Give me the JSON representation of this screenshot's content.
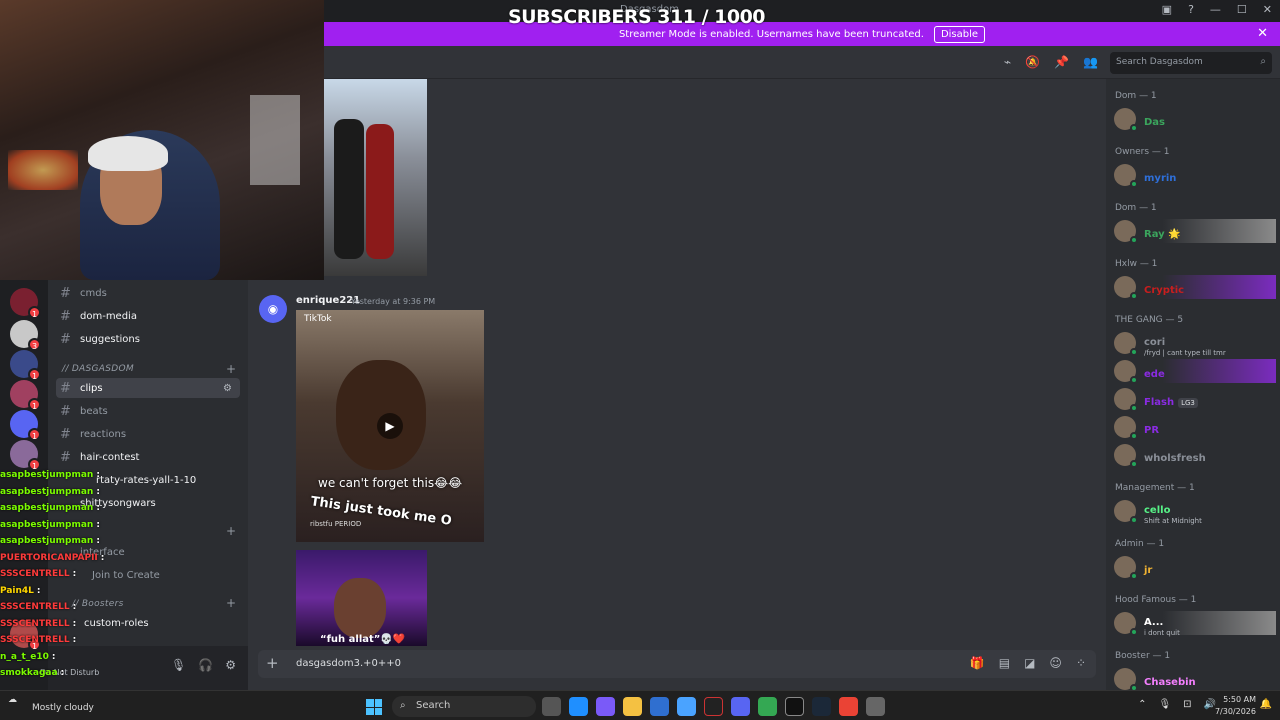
{
  "window": {
    "title": "Dasgasdom",
    "overlay": "SUBSCRIBERS 311 / 1000"
  },
  "banner": {
    "text": "Streamer Mode is enabled. Usernames have been truncated.",
    "button": "Disable"
  },
  "header": {
    "search_placeholder": "Search Dasgasdom"
  },
  "channels": {
    "top": [
      {
        "name": "cmds"
      },
      {
        "name": "dom-media"
      },
      {
        "name": "suggestions"
      }
    ],
    "category1": "// DASGASDOM",
    "list": [
      {
        "name": "clips"
      },
      {
        "name": "beats"
      },
      {
        "name": "reactions"
      },
      {
        "name": "hair-contest"
      },
      {
        "name": "rtaty-rates-yall-1-10"
      },
      {
        "name": "shittysongwars"
      }
    ],
    "voice1": "interface",
    "voice2": "Join to Create",
    "category2": "// Boosters",
    "boosters": [
      {
        "name": "custom-roles"
      }
    ]
  },
  "chat_overlay": [
    {
      "user": "asapbestjumpman",
      "msg": ":",
      "color": "#7CFC00"
    },
    {
      "user": "asapbestjumpman",
      "msg": ":",
      "color": "#7CFC00"
    },
    {
      "user": "asapbestjumpman",
      "msg": ":",
      "color": "#7CFC00"
    },
    {
      "user": "asapbestjumpman",
      "msg": ":",
      "color": "#7CFC00"
    },
    {
      "user": "asapbestjumpman",
      "msg": ":",
      "color": "#7CFC00"
    },
    {
      "user": "PUERTORICANPAPII",
      "msg": ":",
      "color": "#ff3b3b"
    },
    {
      "user": "SSSCENTRELL",
      "msg": ":",
      "color": "#ff3b3b"
    },
    {
      "user": "Pain4L",
      "msg": ":",
      "color": "#ffd700"
    },
    {
      "user": "SSSCENTRELL",
      "msg": ":",
      "color": "#ff3b3b"
    },
    {
      "user": "SSSCENTRELL",
      "msg": ":",
      "color": "#ff3b3b"
    },
    {
      "user": "SSSCENTRELL",
      "msg": ":",
      "color": "#ff3b3b"
    },
    {
      "user": "n_a_t_e10",
      "msg": ":",
      "color": "#7CFC00"
    },
    {
      "user": "smokkagaa",
      "msg": ":",
      "color": "#7CFC00"
    }
  ],
  "user_panel": {
    "status": "Do Not Disturb"
  },
  "message": {
    "author": "enrique221",
    "timestamp": "Yesterday at 9:36 PM",
    "video1": {
      "watermark": "TikTok",
      "caption": "we can't forget this😂😂",
      "caption2": "This just took me O",
      "credit": "ribstfu PERIOD"
    },
    "video2": {
      "caption": "“fuh allat”💀❤️"
    }
  },
  "composer": {
    "text": "dasgasdom3.+0++0"
  },
  "members": [
    {
      "role": "Dom — 1",
      "users": [
        {
          "name": "Das",
          "color": "#3ba55d"
        }
      ]
    },
    {
      "role": "Owners — 1",
      "users": [
        {
          "name": "myrin",
          "color": "#2e6fd9"
        }
      ]
    },
    {
      "role": "Dom — 1",
      "users": [
        {
          "name": "Ray 🌟",
          "color": "#3ba55d"
        }
      ]
    },
    {
      "role": "Hxlw — 1",
      "users": [
        {
          "name": "Cryptic",
          "color": "#c81e1e"
        }
      ]
    },
    {
      "role": "THE GANG — 5",
      "users": [
        {
          "name": "cori",
          "color": "#8a8f98",
          "status": "/fryd | cant type till tmr"
        },
        {
          "name": "ede",
          "color": "#8a2be2"
        },
        {
          "name": "Flash",
          "color": "#8a2be2",
          "tag": "LG3"
        },
        {
          "name": "PR",
          "color": "#8a2be2"
        },
        {
          "name": "wholsfresh",
          "color": "#8a8f98"
        }
      ]
    },
    {
      "role": "Management — 1",
      "users": [
        {
          "name": "cello",
          "color": "#57f287",
          "status": "Shift at Midnight"
        }
      ]
    },
    {
      "role": "Admin — 1",
      "users": [
        {
          "name": "jr",
          "color": "#f0b232"
        }
      ]
    },
    {
      "role": "Hood Famous — 1",
      "users": [
        {
          "name": "A...",
          "color": "#ffffff",
          "status": "i dont quit"
        }
      ]
    },
    {
      "role": "Booster — 1",
      "users": [
        {
          "name": "Chasebin",
          "color": "#f47fff"
        }
      ]
    }
  ],
  "taskbar": {
    "weather": "Mostly cloudy",
    "search": "Search",
    "time": "5:50 AM",
    "date": "7/30/2026"
  }
}
